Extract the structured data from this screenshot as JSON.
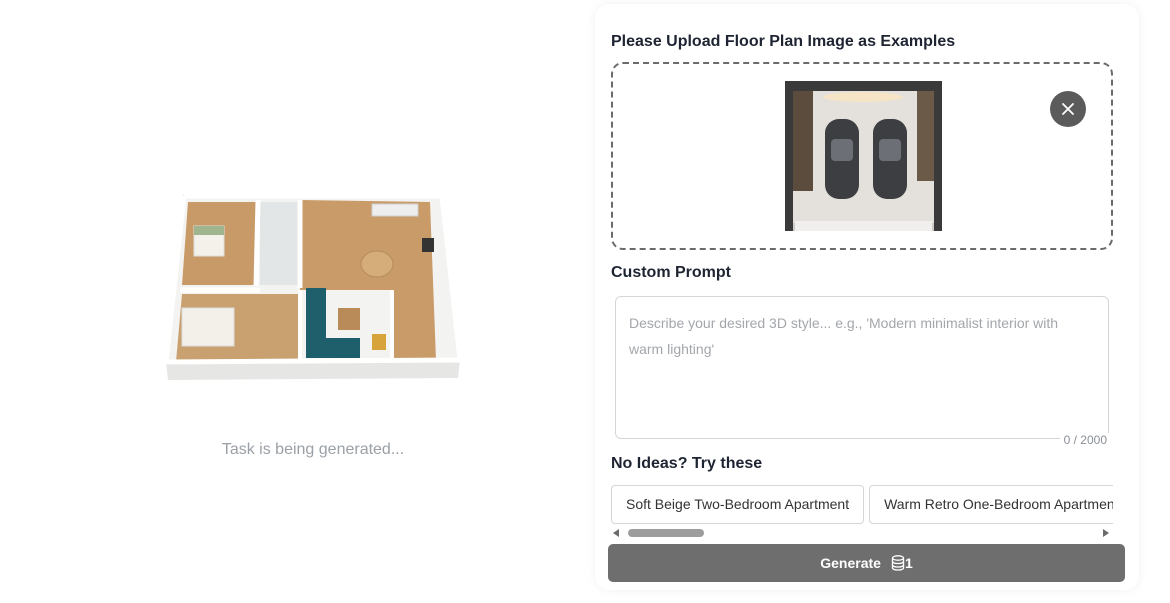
{
  "preview": {
    "status": "Task is being generated..."
  },
  "upload": {
    "title": "Please Upload Floor Plan Image as Examples"
  },
  "prompt": {
    "title": "Custom Prompt",
    "placeholder": "Describe your desired 3D style... e.g., 'Modern minimalist interior with warm lighting'",
    "value": "",
    "counter": "0 / 2000"
  },
  "ideas": {
    "title": "No Ideas? Try these",
    "chips": [
      "Soft Beige Two-Bedroom Apartment",
      "Warm Retro One-Bedroom Apartment"
    ]
  },
  "generate": {
    "label": "Generate",
    "cost": "1"
  },
  "icons": {
    "remove": "close-icon",
    "coin": "coin-stack-icon",
    "scroll_left": "caret-left-icon",
    "scroll_right": "caret-right-icon"
  },
  "colors": {
    "button": "#6e6e6e",
    "remove_button": "#5b5b5b",
    "sofa": "#1f5f6b"
  }
}
